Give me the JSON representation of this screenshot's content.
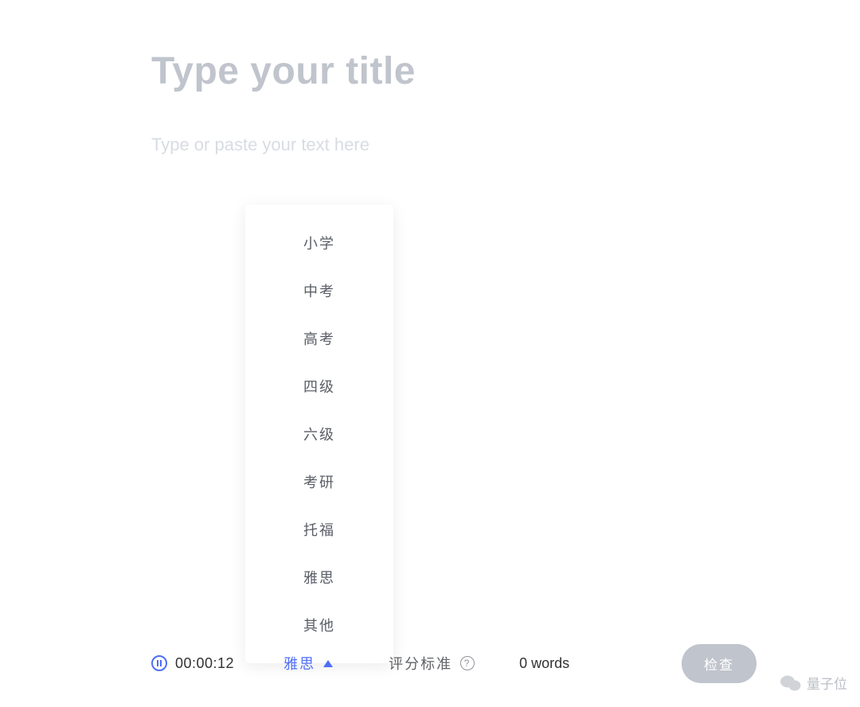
{
  "editor": {
    "title_placeholder": "Type your title",
    "body_placeholder": "Type or paste your text here"
  },
  "dropdown": {
    "items": [
      "小学",
      "中考",
      "高考",
      "四级",
      "六级",
      "考研",
      "托福",
      "雅思",
      "其他"
    ]
  },
  "bottom_bar": {
    "timer": "00:00:12",
    "selected_level": "雅思",
    "criteria_label": "评分标准",
    "word_count": "0 words",
    "check_button": "检查"
  },
  "watermark": {
    "text": "量子位"
  }
}
